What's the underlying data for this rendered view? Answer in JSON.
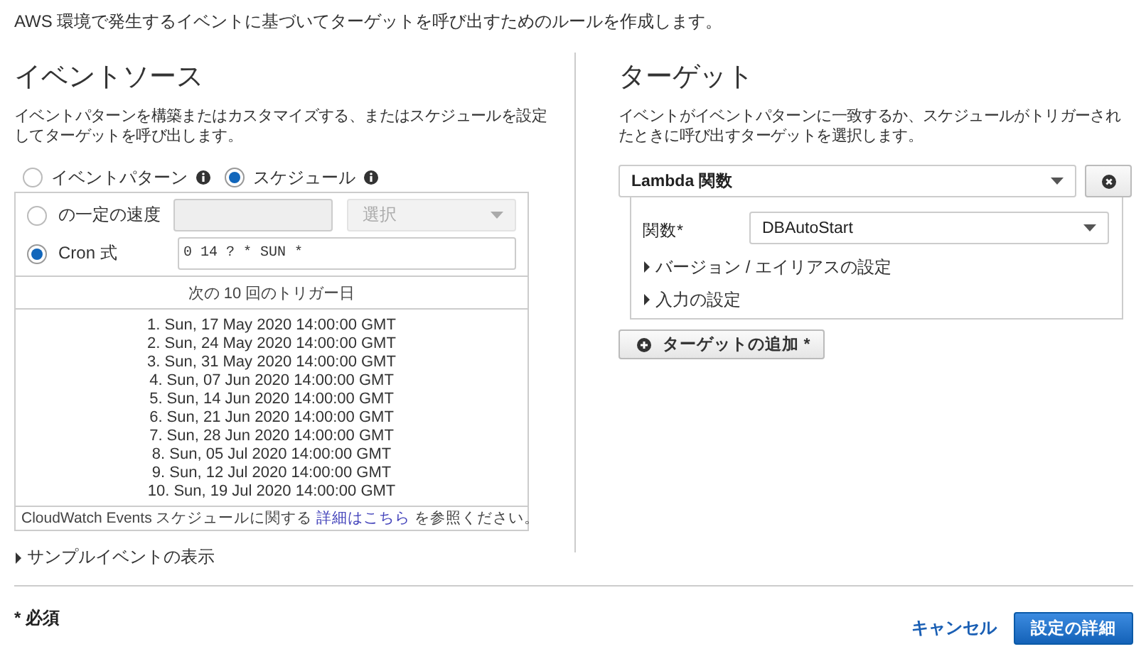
{
  "intro": "AWS 環境で発生するイベントに基づいてターゲットを呼び出すためのルールを作成します。",
  "source": {
    "title": "イベントソース",
    "description": "イベントパターンを構築またはカスタマイズする、またはスケジュールを設定してターゲットを呼び出します。",
    "modes": [
      {
        "label": "イベントパターン",
        "selected": false
      },
      {
        "label": "スケジュール",
        "selected": true
      }
    ],
    "schedule_options": [
      {
        "kind": "rate",
        "label": "の一定の速度",
        "selected": false,
        "unit": {
          "placeholder": "選択",
          "disabled": true
        }
      },
      {
        "kind": "cron",
        "label": "Cron 式",
        "selected": true,
        "value": "0 14 ? * SUN *"
      }
    ],
    "trigger_heading": "次の 10 回のトリガー日",
    "triggers": [
      "1. Sun, 17 May 2020 14:00:00 GMT",
      "2. Sun, 24 May 2020 14:00:00 GMT",
      "3. Sun, 31 May 2020 14:00:00 GMT",
      "4. Sun, 07 Jun 2020 14:00:00 GMT",
      "5. Sun, 14 Jun 2020 14:00:00 GMT",
      "6. Sun, 21 Jun 2020 14:00:00 GMT",
      "7. Sun, 28 Jun 2020 14:00:00 GMT",
      "8. Sun, 05 Jul 2020 14:00:00 GMT",
      "9. Sun, 12 Jul 2020 14:00:00 GMT",
      "10. Sun, 19 Jul 2020 14:00:00 GMT"
    ],
    "help": {
      "before": "CloudWatch Events スケジュールに関する ",
      "link": "詳細はこちら",
      "after": " を参照ください。"
    },
    "sample": {
      "label": "サンプルイベントの表示",
      "expanded": false
    }
  },
  "target": {
    "title": "ターゲット",
    "description": "イベントがイベントパターンに一致するか、スケジュールがトリガーされたときに呼び出すターゲットを選択します。",
    "type": "Lambda 関数",
    "function": {
      "label": "関数*",
      "value": "DBAutoStart"
    },
    "sections": [
      {
        "label": "バージョン / エイリアスの設定",
        "expanded": false
      },
      {
        "label": "入力の設定",
        "expanded": false
      }
    ],
    "add_button": "ターゲットの追加 *"
  },
  "footer": {
    "required": "* 必須",
    "cancel": "キャンセル",
    "submit": "設定の詳細"
  }
}
